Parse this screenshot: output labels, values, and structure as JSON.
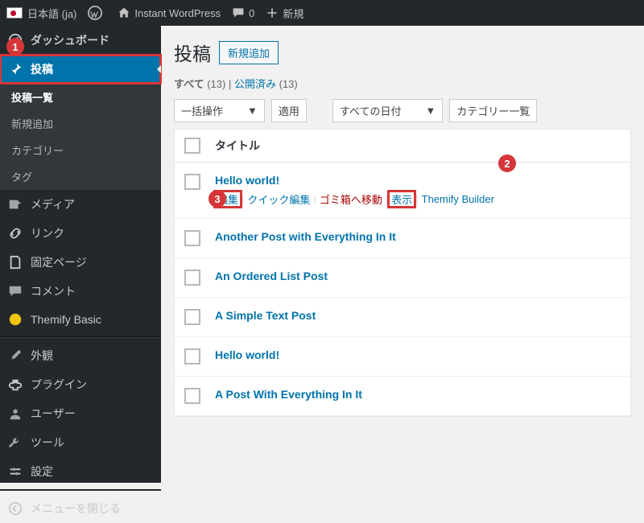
{
  "adminbar": {
    "language": "日本語 (ja)",
    "site": "Instant WordPress",
    "comments": "0",
    "new": "新規"
  },
  "sidebar": {
    "dashboard": "ダッシュボード",
    "posts": "投稿",
    "posts_sub": [
      "投稿一覧",
      "新規追加",
      "カテゴリー",
      "タグ"
    ],
    "media": "メディア",
    "links": "リンク",
    "pages": "固定ページ",
    "comments": "コメント",
    "themify": "Themify Basic",
    "appearance": "外観",
    "plugins": "プラグイン",
    "users": "ユーザー",
    "tools": "ツール",
    "settings": "設定",
    "collapse": "メニューを閉じる"
  },
  "page": {
    "heading": "投稿",
    "addnew": "新規追加",
    "filter_all": "すべて",
    "filter_all_count": "(13)",
    "filter_published": "公開済み",
    "filter_published_count": "(13)",
    "bulk": "一括操作",
    "apply": "適用",
    "dates": "すべての日付",
    "cats": "カテゴリー一覧",
    "coltitle": "タイトル",
    "rows": [
      {
        "title": "Hello world!",
        "actions": true
      },
      {
        "title": "Another Post with Everything In It"
      },
      {
        "title": "An Ordered List Post"
      },
      {
        "title": "A Simple Text Post"
      },
      {
        "title": "Hello world!"
      },
      {
        "title": "A Post With Everything In It"
      }
    ],
    "act_edit": "編集",
    "act_quick": "クイック編集",
    "act_trash": "ゴミ箱へ移動",
    "act_view": "表示",
    "act_builder": "Themify Builder"
  }
}
